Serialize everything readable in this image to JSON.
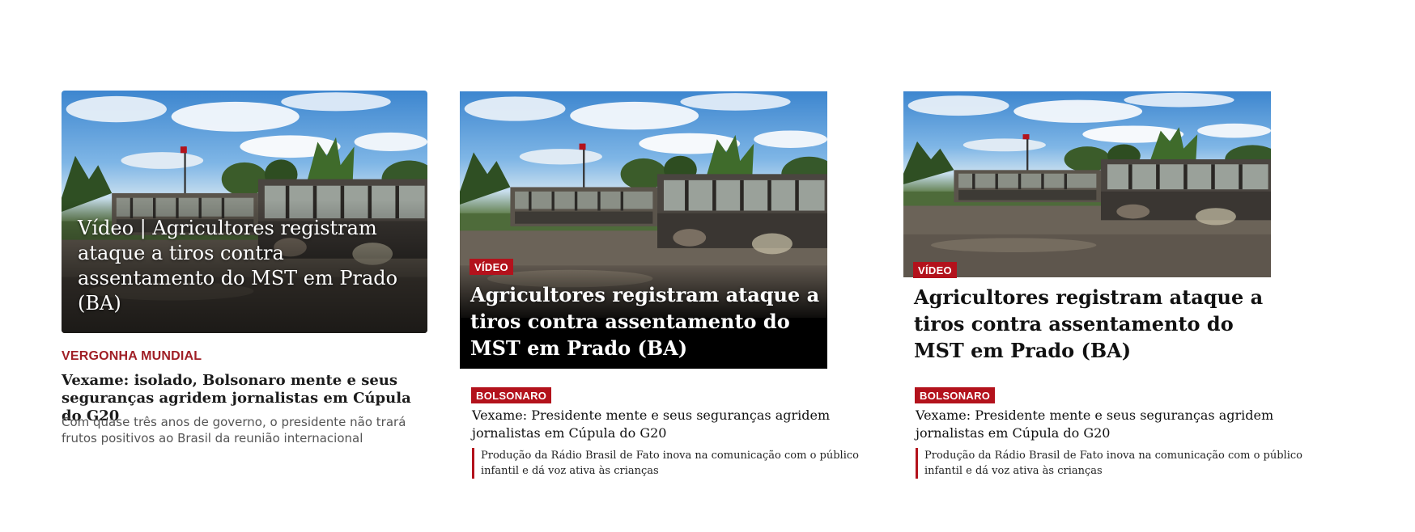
{
  "card1": {
    "image_alt": "burned-buses-photo",
    "overlay_title": "Vídeo | Agricultores registram ataque a tiros contra assentamento do MST em Prado (BA)",
    "kicker": "VERGONHA MUNDIAL",
    "headline": "Vexame: isolado, Bolsonaro mente e seus seguranças agridem jornalistas em Cúpula do G20",
    "dek": "Com quase três anos de governo, o presidente não trará frutos positivos ao Brasil da reunião internacional"
  },
  "card2": {
    "image_alt": "burned-buses-photo",
    "badge": "VÍDEO",
    "overlay_title": "Agricultores registram ataque a tiros contra assentamento do MST em Prado (BA)",
    "tag": "BOLSONARO",
    "sub_headline": "Vexame: Presidente mente e seus seguranças agridem jornalistas em Cúpula do G20",
    "related": "Produção da Rádio Brasil de Fato inova na comunicação com o público infantil e dá voz ativa às crianças"
  },
  "card3": {
    "image_alt": "burned-buses-photo",
    "badge": "VÍDEO",
    "title": "Agricultores registram ataque a tiros contra assentamento do MST em Prado (BA)",
    "tag": "BOLSONARO",
    "sub_headline": "Vexame: Presidente mente e seus seguranças agridem jornalistas em Cúpula do G20",
    "related": "Produção da Rádio Brasil de Fato inova na comunicação com o público infantil e dá voz ativa às crianças"
  },
  "colors": {
    "accent_red": "#b3121c",
    "kicker_red": "#a01f26"
  }
}
